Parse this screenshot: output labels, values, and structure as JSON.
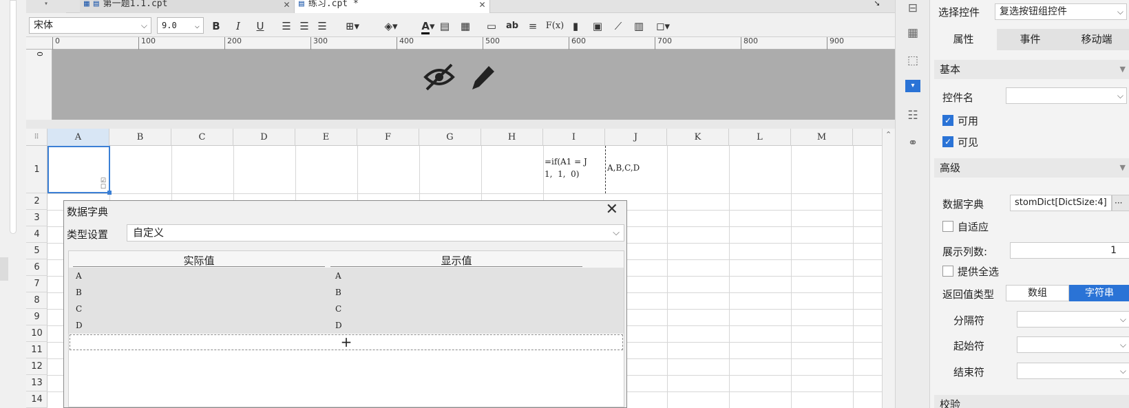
{
  "tabs": [
    {
      "label": "第一题1.1.cpt",
      "active": false
    },
    {
      "label": "练习.cpt *",
      "active": true
    }
  ],
  "toolbar": {
    "font": "宋体",
    "size": "9.0",
    "bold": "B",
    "italic": "I",
    "underline": "U",
    "text_ab": "ab",
    "formula": "F(x)"
  },
  "ruler": {
    "marks": [
      "0",
      "100",
      "200",
      "300",
      "400",
      "500",
      "600",
      "700",
      "800",
      "900"
    ],
    "vmark": "0"
  },
  "columns": [
    "A",
    "B",
    "C",
    "D",
    "E",
    "F",
    "G",
    "H",
    "I",
    "J",
    "K",
    "L",
    "M"
  ],
  "rows": [
    "1",
    "2",
    "3",
    "4",
    "5",
    "6",
    "7",
    "8",
    "9",
    "10",
    "11",
    "12",
    "13",
    "14"
  ],
  "cells": {
    "I1": "=if(A1 = J\n1,  1,  0)",
    "J1": "A,B,C,D"
  },
  "dialog": {
    "title": "数据字典",
    "type_label": "类型设置",
    "type_value": "自定义",
    "col_actual": "实际值",
    "col_display": "显示值",
    "entries": [
      {
        "actual": "A",
        "display": "A"
      },
      {
        "actual": "B",
        "display": "B"
      },
      {
        "actual": "C",
        "display": "C"
      },
      {
        "actual": "D",
        "display": "D"
      }
    ],
    "add": "+"
  },
  "panel": {
    "select_label": "选择控件",
    "select_value": "复选按钮组控件",
    "tabs": [
      "属性",
      "事件",
      "移动端"
    ],
    "basic": "基本",
    "name_label": "控件名",
    "enabled": "可用",
    "visible": "可见",
    "advanced": "高级",
    "dict_label": "数据字典",
    "dict_value": "stomDict[DictSize:4]",
    "dict_btn": "···",
    "adaptive": "自适应",
    "cols_label": "展示列数:",
    "cols_value": "1",
    "select_all": "提供全选",
    "return_label": "返回值类型",
    "return_array": "数组",
    "return_string": "字符串",
    "sep_label": "分隔符",
    "start_label": "起始符",
    "end_label": "结束符",
    "verify": "校验"
  },
  "colors": {
    "accent": "#2a73d6",
    "selection": "#3a7fd5"
  }
}
